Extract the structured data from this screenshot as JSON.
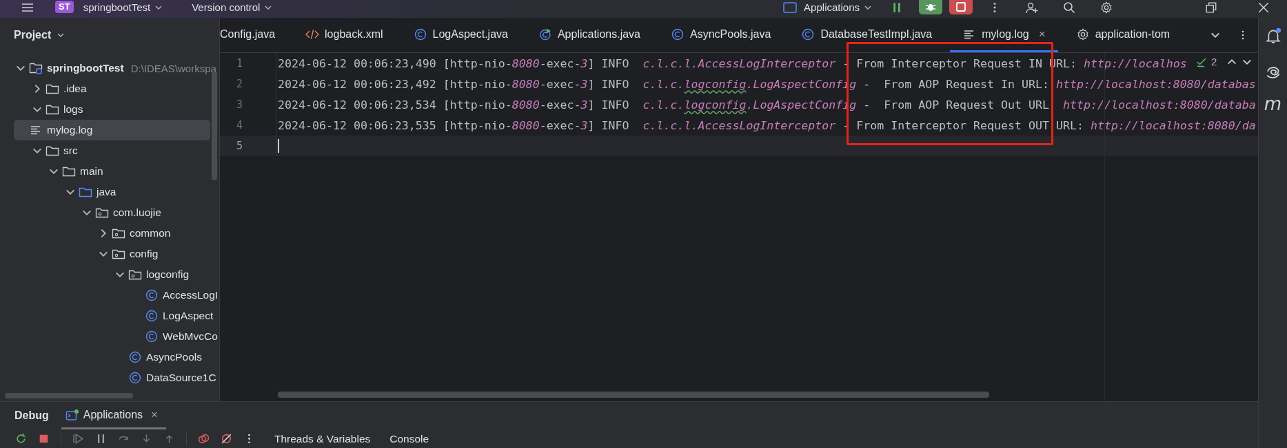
{
  "title_bar": {
    "project_badge": "ST",
    "project_name": "springbootTest",
    "vcs": "Version control",
    "run_config": "Applications"
  },
  "project": {
    "title": "Project",
    "tree": [
      {
        "label": "springbootTest",
        "path": "D:\\IDEAS\\workspa",
        "kind": "module",
        "expanded": true,
        "selected": false,
        "children": [
          {
            "label": ".idea",
            "kind": "folder",
            "expanded": false,
            "selected": false
          },
          {
            "label": "logs",
            "kind": "folder",
            "expanded": true,
            "selected": false,
            "children": [
              {
                "label": "mylog.log",
                "kind": "log",
                "selected": true
              }
            ]
          },
          {
            "label": "src",
            "kind": "folder",
            "expanded": true,
            "selected": false,
            "children": [
              {
                "label": "main",
                "kind": "folder",
                "expanded": true,
                "selected": false,
                "children": [
                  {
                    "label": "java",
                    "kind": "source",
                    "expanded": true,
                    "selected": false,
                    "children": [
                      {
                        "label": "com.luojie",
                        "kind": "package",
                        "expanded": true,
                        "selected": false,
                        "children": [
                          {
                            "label": "common",
                            "kind": "package",
                            "expanded": false,
                            "selected": false
                          },
                          {
                            "label": "config",
                            "kind": "package",
                            "expanded": true,
                            "selected": false,
                            "children": [
                              {
                                "label": "logconfig",
                                "kind": "package",
                                "expanded": true,
                                "selected": false,
                                "children": [
                                  {
                                    "label": "AccessLogI",
                                    "kind": "class",
                                    "selected": false
                                  },
                                  {
                                    "label": "LogAspect",
                                    "kind": "class",
                                    "selected": false
                                  },
                                  {
                                    "label": "WebMvcCo",
                                    "kind": "class",
                                    "selected": false
                                  }
                                ]
                              },
                              {
                                "label": "AsyncPools",
                                "kind": "class",
                                "selected": false
                              },
                              {
                                "label": "DataSource1C",
                                "kind": "class",
                                "selected": false
                              }
                            ]
                          }
                        ]
                      }
                    ]
                  }
                ]
              }
            ]
          }
        ]
      }
    ]
  },
  "editor_tabs": [
    {
      "label": "Config.java",
      "kind": "none",
      "selected": false
    },
    {
      "label": "logback.xml",
      "kind": "xml",
      "selected": false
    },
    {
      "label": "LogAspect.java",
      "kind": "class",
      "selected": false
    },
    {
      "label": "Applications.java",
      "kind": "runnable",
      "selected": false
    },
    {
      "label": "AsyncPools.java",
      "kind": "class",
      "selected": false
    },
    {
      "label": "DatabaseTestImpl.java",
      "kind": "class",
      "selected": false
    },
    {
      "label": "mylog.log",
      "kind": "log",
      "selected": true,
      "close": "×"
    },
    {
      "label": "application-tom",
      "kind": "gear",
      "selected": false
    }
  ],
  "editor": {
    "problem_count": "2",
    "lines": [
      {
        "number": "1",
        "current": false,
        "segments": [
          {
            "kind": "text",
            "text": "2024-06-12 00:06:23,490 [http-nio-"
          },
          {
            "kind": "number",
            "text": "8080"
          },
          {
            "kind": "text",
            "text": "-exec-"
          },
          {
            "kind": "number",
            "text": "3"
          },
          {
            "kind": "text",
            "text": "] INFO  "
          },
          {
            "kind": "logger",
            "text": "c.l.c.l.AccessLogInterceptor"
          },
          {
            "kind": "text",
            "text": " - From Interceptor Request IN URL: "
          },
          {
            "kind": "link",
            "text": "http://localhos"
          }
        ]
      },
      {
        "number": "2",
        "current": false,
        "segments": [
          {
            "kind": "text",
            "text": "2024-06-12 00:06:23,492 [http-nio-"
          },
          {
            "kind": "number",
            "text": "8080"
          },
          {
            "kind": "text",
            "text": "-exec-"
          },
          {
            "kind": "number",
            "text": "3"
          },
          {
            "kind": "text",
            "text": "] INFO  "
          },
          {
            "kind": "logger",
            "text": "c.l.c."
          },
          {
            "kind": "typo",
            "text": "logconfig"
          },
          {
            "kind": "logger",
            "text": ".LogAspectConfig"
          },
          {
            "kind": "text",
            "text": " -  From AOP Request In URL: "
          },
          {
            "kind": "link",
            "text": "http://localhost:8080/databas"
          }
        ]
      },
      {
        "number": "3",
        "current": false,
        "segments": [
          {
            "kind": "text",
            "text": "2024-06-12 00:06:23,534 [http-nio-"
          },
          {
            "kind": "number",
            "text": "8080"
          },
          {
            "kind": "text",
            "text": "-exec-"
          },
          {
            "kind": "number",
            "text": "3"
          },
          {
            "kind": "text",
            "text": "] INFO  "
          },
          {
            "kind": "logger",
            "text": "c.l.c."
          },
          {
            "kind": "typo",
            "text": "logconfig"
          },
          {
            "kind": "logger",
            "text": ".LogAspectConfig"
          },
          {
            "kind": "text",
            "text": " -  From AOP Request Out URL  "
          },
          {
            "kind": "link",
            "text": "http://localhost:8080/databa"
          }
        ]
      },
      {
        "number": "4",
        "current": false,
        "segments": [
          {
            "kind": "text",
            "text": "2024-06-12 00:06:23,535 [http-nio-"
          },
          {
            "kind": "number",
            "text": "8080"
          },
          {
            "kind": "text",
            "text": "-exec-"
          },
          {
            "kind": "number",
            "text": "3"
          },
          {
            "kind": "text",
            "text": "] INFO  "
          },
          {
            "kind": "logger",
            "text": "c.l.c.l.AccessLogInterceptor"
          },
          {
            "kind": "text",
            "text": " - From Interceptor Request OUT URL: "
          },
          {
            "kind": "link",
            "text": "http://localhost:8080/da"
          }
        ]
      },
      {
        "number": "5",
        "current": true
      }
    ]
  },
  "debug": {
    "title": "Debug",
    "tabs": [
      {
        "label": "Applications",
        "selected": true,
        "close": "×"
      }
    ],
    "subtabs": [
      {
        "label": "Threads & Variables"
      },
      {
        "label": "Console"
      }
    ]
  },
  "right_toolbar": {
    "maven": "m"
  }
}
